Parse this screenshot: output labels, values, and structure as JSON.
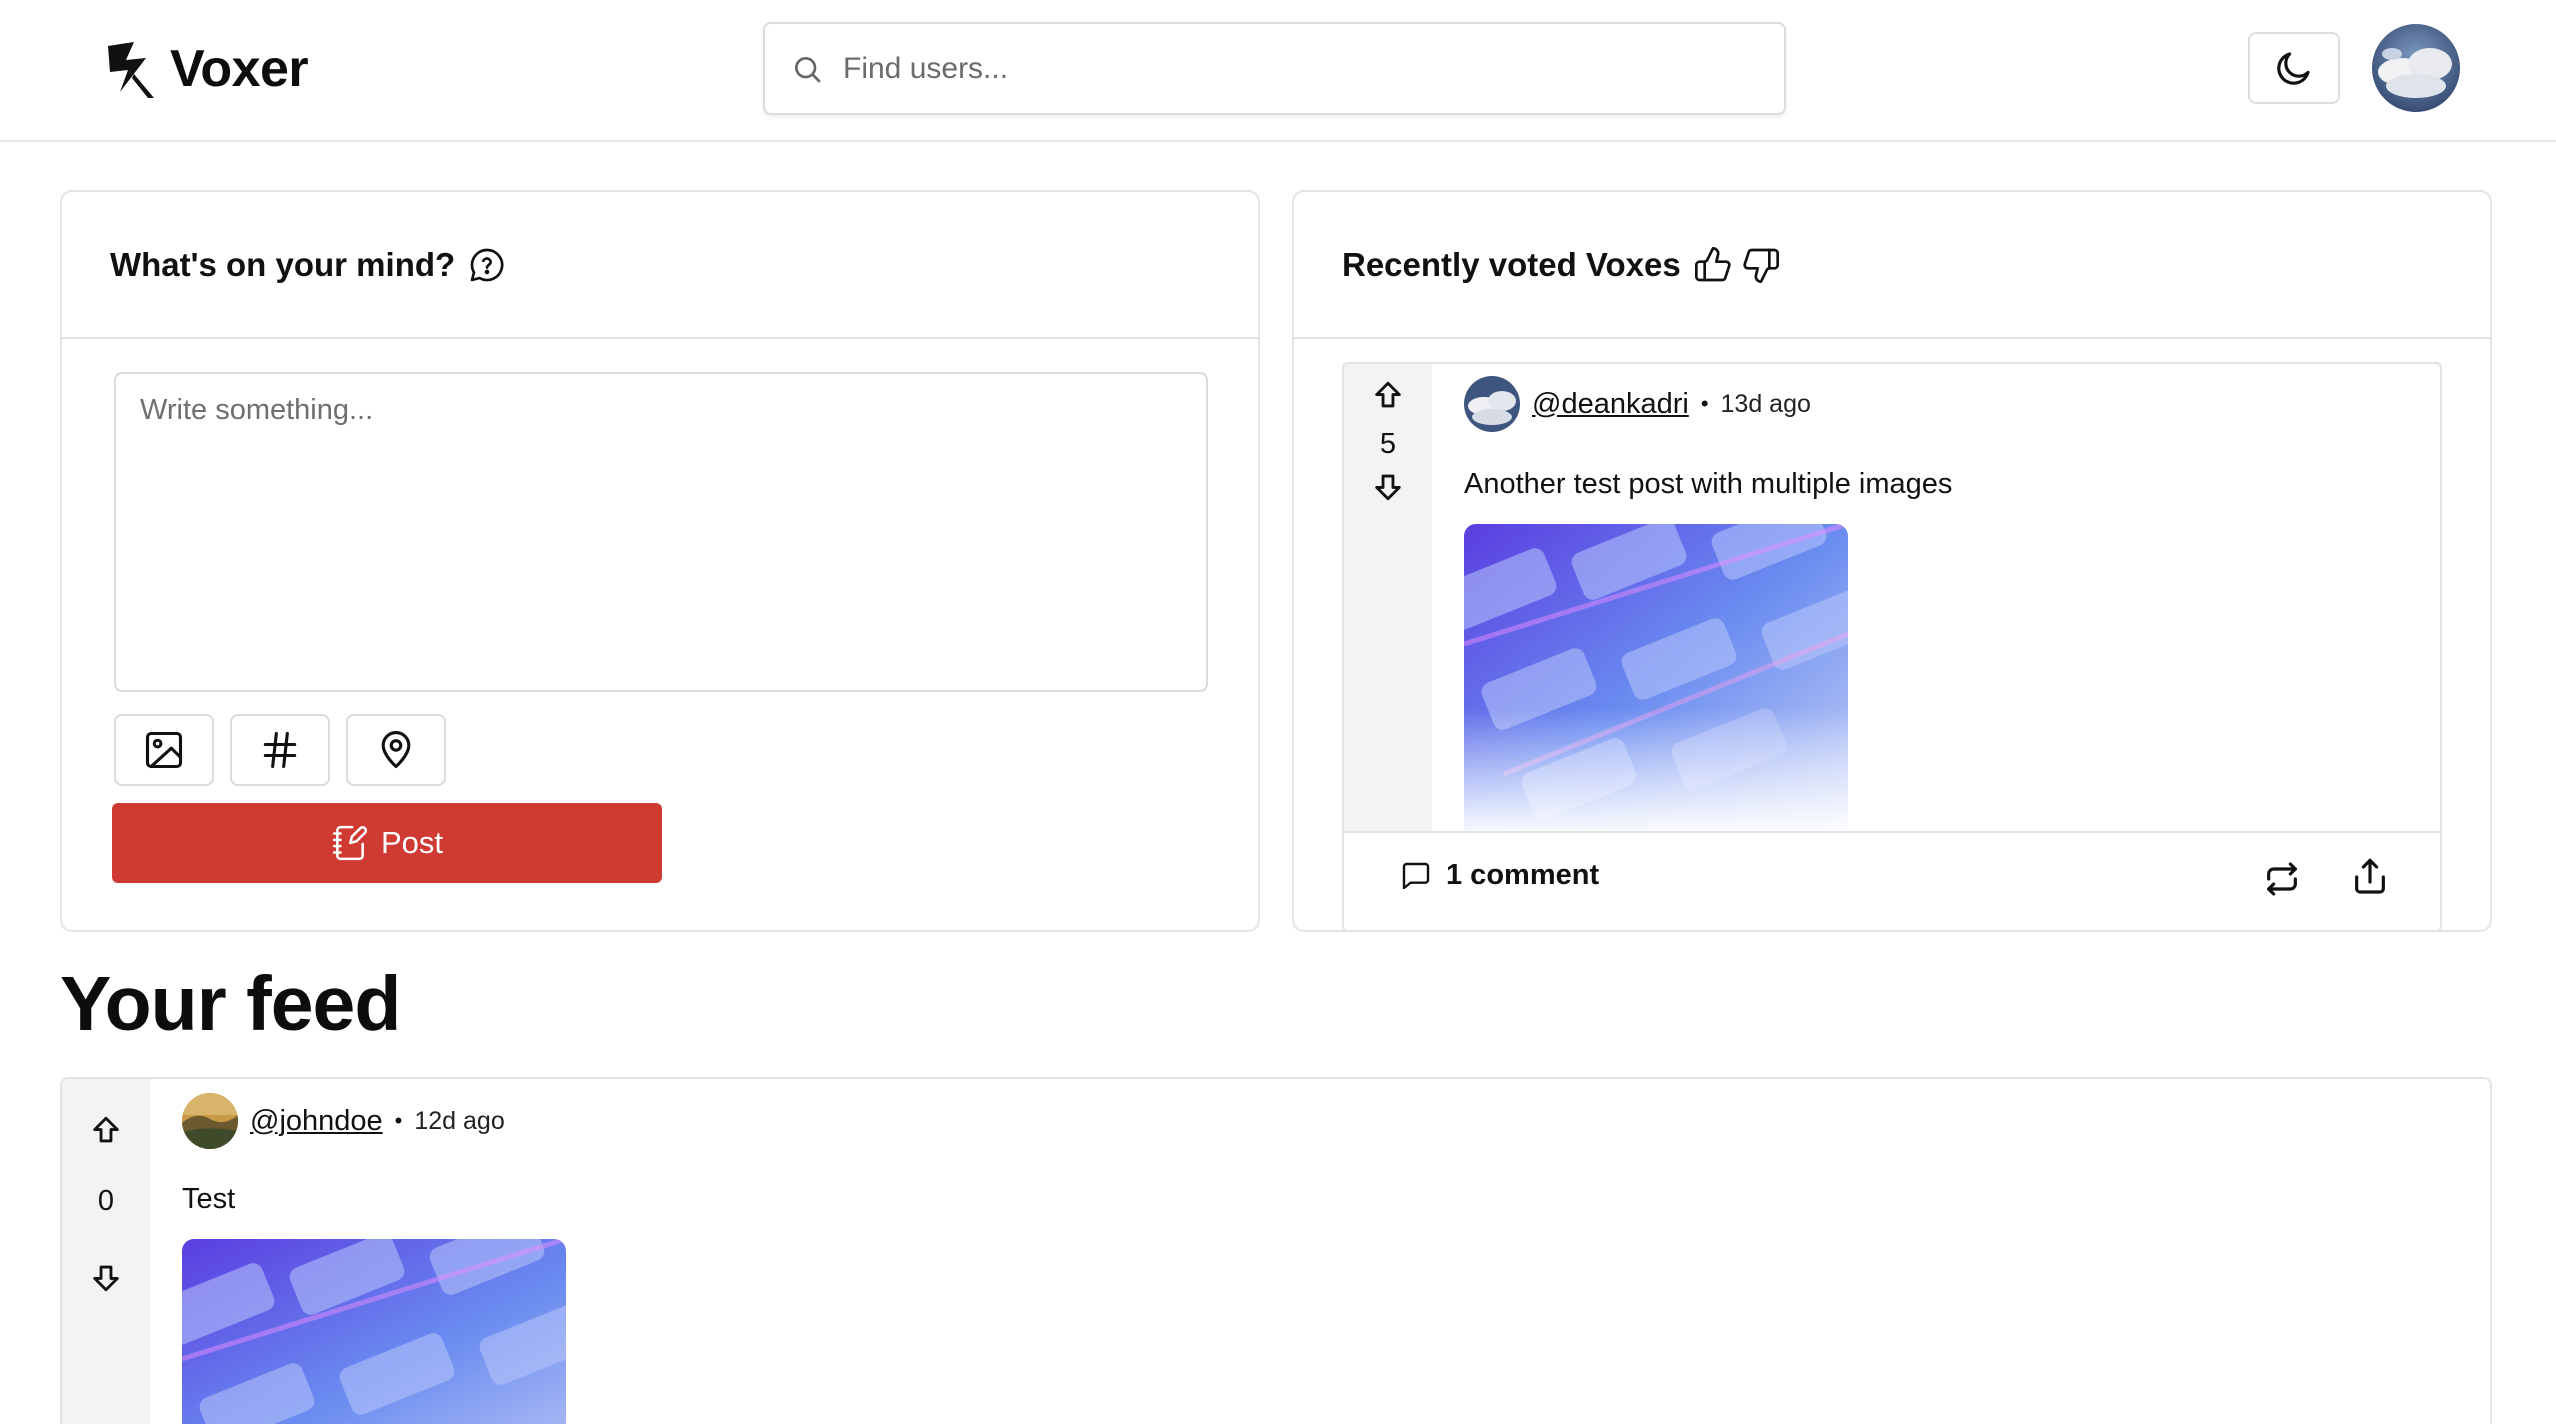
{
  "header": {
    "app_name": "Voxer",
    "search_placeholder": "Find users...",
    "icons": [
      "lightning-logo-icon",
      "search-icon",
      "moon-icon",
      "user-avatar"
    ]
  },
  "compose": {
    "title": "What's on your mind?",
    "title_icon": "chat-question-icon",
    "textarea_placeholder": "Write something...",
    "tools": [
      {
        "name": "image-upload-button",
        "icon": "image-icon"
      },
      {
        "name": "hashtag-button",
        "icon": "hashtag-icon"
      },
      {
        "name": "location-button",
        "icon": "map-pin-icon"
      }
    ],
    "post_label": "Post",
    "post_color": "#cf3a33"
  },
  "voted": {
    "title": "Recently voted Voxes",
    "post": {
      "score": "5",
      "username": "@deankadri",
      "separator": "•",
      "time": "13d ago",
      "text": "Another test post with multiple images",
      "comments": "1 comment"
    }
  },
  "feed": {
    "title": "Your feed",
    "post": {
      "score": "0",
      "username": "@johndoe",
      "separator": "•",
      "time": "12d ago",
      "text": "Test"
    }
  }
}
